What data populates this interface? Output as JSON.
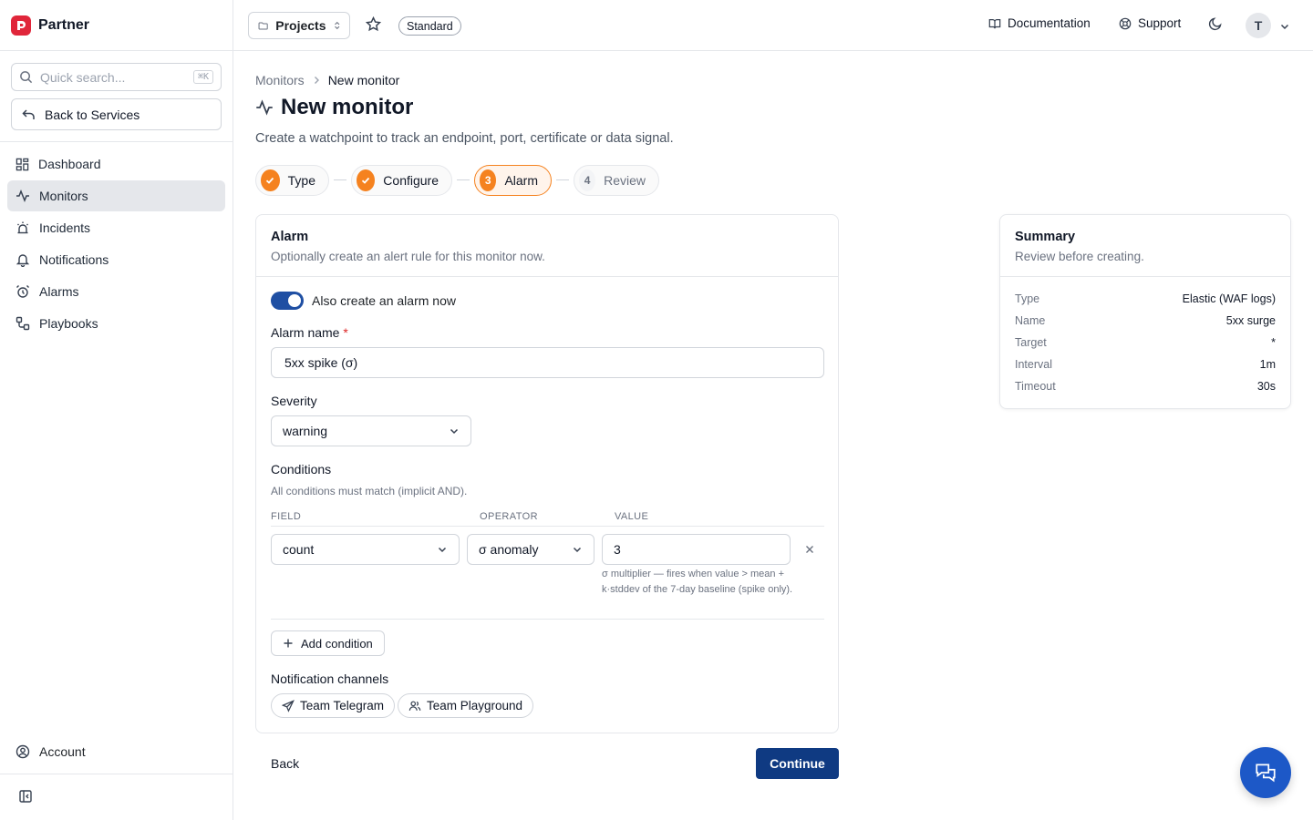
{
  "brand": {
    "name": "Partner",
    "logo_icon": "brand-logo-icon",
    "color": "#e0263a"
  },
  "search": {
    "placeholder": "Quick search...",
    "shortcut": "⌘K"
  },
  "back_to_services": "Back to Services",
  "nav": [
    {
      "label": "Dashboard",
      "icon": "grid-icon",
      "active": false
    },
    {
      "label": "Monitors",
      "icon": "activity-icon",
      "active": true
    },
    {
      "label": "Incidents",
      "icon": "siren-icon",
      "active": false
    },
    {
      "label": "Notifications",
      "icon": "bell-icon",
      "active": false
    },
    {
      "label": "Alarms",
      "icon": "alarm-clock-icon",
      "active": false
    },
    {
      "label": "Playbooks",
      "icon": "workflow-icon",
      "active": false
    }
  ],
  "account_label": "Account",
  "topbar": {
    "project_selector": "Projects",
    "plan": "Standard",
    "documentation": "Documentation",
    "support": "Support",
    "avatar_initial": "T"
  },
  "breadcrumb": {
    "parent": "Monitors",
    "current": "New monitor"
  },
  "page": {
    "title": "New monitor",
    "subtitle": "Create a watchpoint to track an endpoint, port, certificate or data signal."
  },
  "steps": [
    {
      "label": "Type",
      "state": "done",
      "number": "1"
    },
    {
      "label": "Configure",
      "state": "done",
      "number": "2"
    },
    {
      "label": "Alarm",
      "state": "current",
      "number": "3"
    },
    {
      "label": "Review",
      "state": "todo",
      "number": "4"
    }
  ],
  "alarm": {
    "title": "Alarm",
    "description": "Optionally create an alert rule for this monitor now.",
    "toggle_label": "Also create an alarm now",
    "toggle_on": true,
    "name_label": "Alarm name",
    "required_mark": "*",
    "name_value": "5xx spike (σ)",
    "severity_label": "Severity",
    "severity_value": "warning",
    "conditions_label": "Conditions",
    "conditions_hint": "All conditions must match (implicit AND).",
    "col_field": "FIELD",
    "col_operator": "OPERATOR",
    "col_value": "VALUE",
    "condition": {
      "field": "count",
      "operator": "σ anomaly",
      "value": "3",
      "help": "σ multiplier — fires when value > mean + k·stddev of the 7-day baseline (spike only)."
    },
    "add_condition": "Add condition",
    "channels_label": "Notification channels",
    "channels": [
      {
        "label": "Team Telegram",
        "icon": "send-icon"
      },
      {
        "label": "Team Playground",
        "icon": "users-icon"
      }
    ]
  },
  "footer": {
    "back": "Back",
    "continue": "Continue"
  },
  "summary": {
    "title": "Summary",
    "description": "Review before creating.",
    "rows": [
      {
        "key": "Type",
        "value": "Elastic (WAF logs)"
      },
      {
        "key": "Name",
        "value": "5xx surge"
      },
      {
        "key": "Target",
        "value": "*"
      },
      {
        "key": "Interval",
        "value": "1m"
      },
      {
        "key": "Timeout",
        "value": "30s"
      }
    ]
  },
  "colors": {
    "accent_orange": "#f5821f",
    "primary_blue": "#0f3a82",
    "toggle_blue": "#1f4fa3",
    "chat_blue": "#1d58c7"
  }
}
